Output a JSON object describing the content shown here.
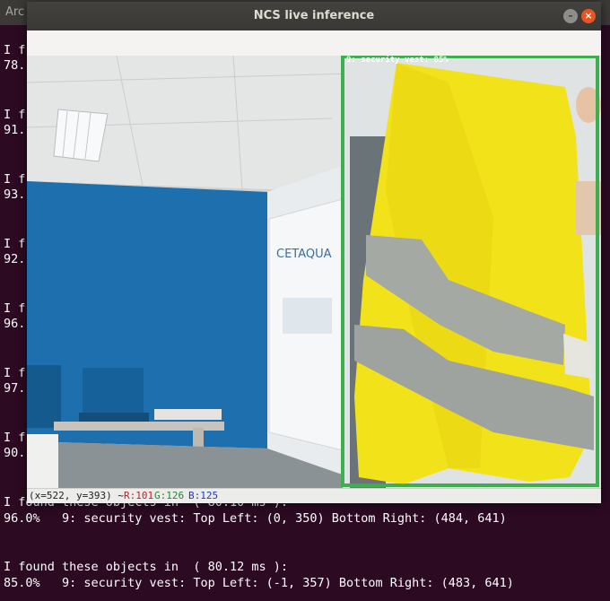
{
  "terminal": {
    "tab_title": "Arc",
    "fragments": [
      {
        "a": "I f",
        "b": "78."
      },
      {
        "a": "I f",
        "b": "91."
      },
      {
        "a": "I f",
        "b": "93."
      },
      {
        "a": "I f",
        "b": "92."
      },
      {
        "a": "I f",
        "b": "96."
      },
      {
        "a": "I f",
        "b": "97."
      },
      {
        "a": "I f",
        "b": "90."
      }
    ],
    "bottom_lines": [
      "I found these objects in  ( 80.10 ms ):",
      "96.0%   9: security vest: Top Left: (0, 350) Bottom Right: (484, 641)",
      "",
      "I found these objects in  ( 80.12 ms ):",
      "85.0%   9: security vest: Top Left: (-1, 357) Bottom Right: (483, 641)"
    ]
  },
  "window": {
    "title": "NCS live inference",
    "minimize_glyph": "–",
    "close_glyph": "×"
  },
  "detection": {
    "label": "9: security vest: 85%",
    "box_color": "#3fae4f",
    "confidence_percent": 85
  },
  "scene": {
    "sign_text": "CETAQUA"
  },
  "status": {
    "coords": "(x=522, y=393) ~",
    "r": "R:101",
    "g": "G:126",
    "b": "B:125"
  },
  "colors": {
    "terminal_bg": "#2c0a22",
    "wall_blue": "#1e6fae",
    "vest_yellow": "#f2e21a",
    "close_button": "#e95420"
  }
}
